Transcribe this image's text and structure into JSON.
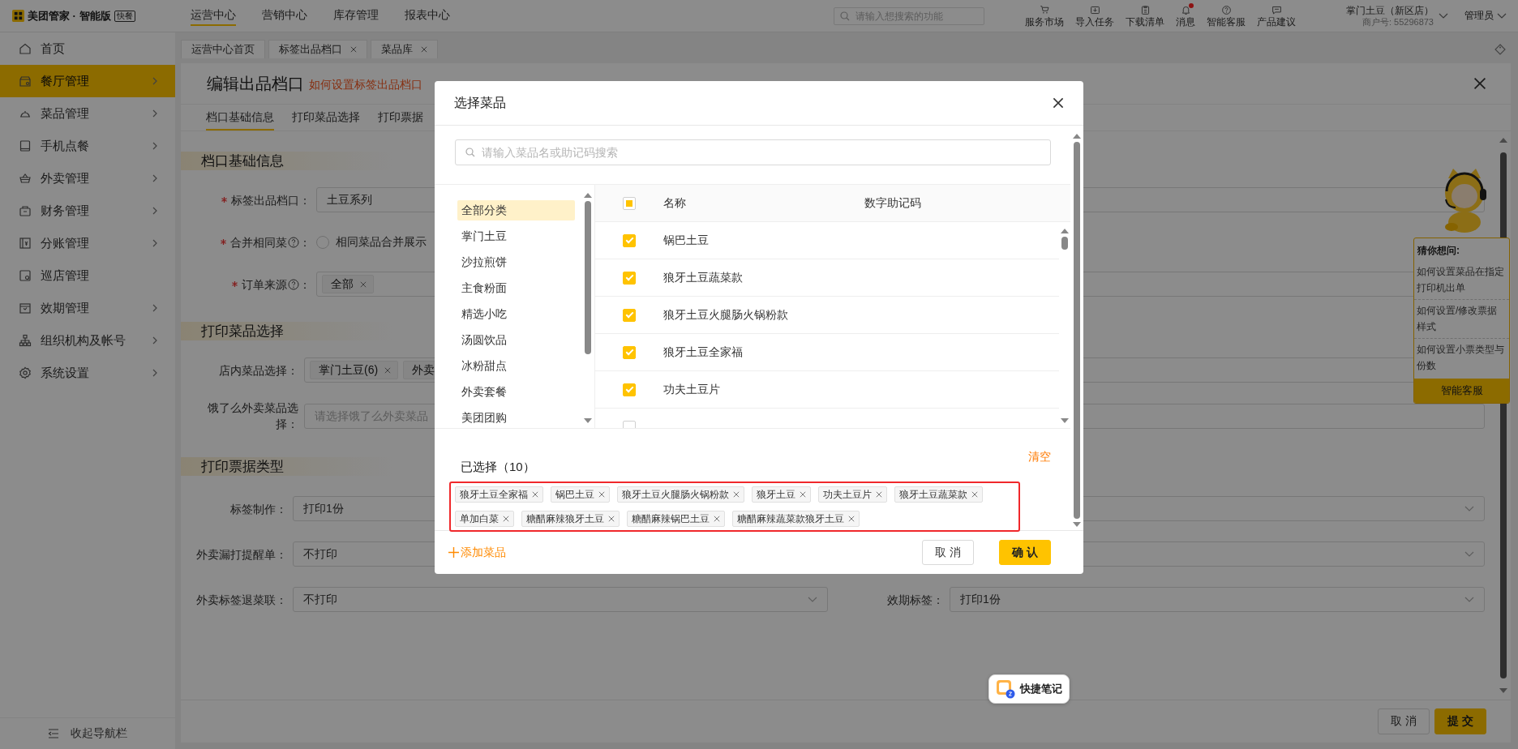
{
  "top_bar": {
    "brand": "美团管家 · 智能版",
    "edition_badge": "快餐",
    "nav": [
      {
        "label": "运营中心",
        "selected": true
      },
      {
        "label": "营销中心",
        "selected": false
      },
      {
        "label": "库存管理",
        "selected": false
      },
      {
        "label": "报表中心",
        "selected": false
      }
    ],
    "search": {
      "placeholder": "请输入想搜索的功能"
    },
    "tools": [
      {
        "label": "服务市场",
        "unread": false
      },
      {
        "label": "导入任务",
        "unread": false
      },
      {
        "label": "下载清单",
        "unread": false
      },
      {
        "label": "消息",
        "unread": true
      },
      {
        "label": "智能客服",
        "unread": false
      },
      {
        "label": "产品建议",
        "unread": false
      }
    ],
    "store": {
      "name": "掌门土豆（新区店）",
      "merchant_id": "商户号: 55296873"
    },
    "user": "管理员"
  },
  "sidebar": {
    "items": [
      {
        "label": "首页",
        "selected": false,
        "has_children": false
      },
      {
        "label": "餐厅管理",
        "selected": true,
        "has_children": true
      },
      {
        "label": "菜品管理",
        "selected": false,
        "has_children": true
      },
      {
        "label": "手机点餐",
        "selected": false,
        "has_children": true
      },
      {
        "label": "外卖管理",
        "selected": false,
        "has_children": true
      },
      {
        "label": "财务管理",
        "selected": false,
        "has_children": true
      },
      {
        "label": "分账管理",
        "selected": false,
        "has_children": true
      },
      {
        "label": "巡店管理",
        "selected": false,
        "has_children": false
      },
      {
        "label": "效期管理",
        "selected": false,
        "has_children": true
      },
      {
        "label": "组织机构及帐号",
        "selected": false,
        "has_children": true
      },
      {
        "label": "系统设置",
        "selected": false,
        "has_children": true
      }
    ],
    "collapse": "收起导航栏"
  },
  "page_tabs": [
    {
      "label": "运营中心首页",
      "closable": false
    },
    {
      "label": "标签出品档口",
      "closable": true
    },
    {
      "label": "菜品库",
      "closable": true
    }
  ],
  "editor": {
    "title": "编辑出品档口",
    "help_link": "如何设置标签出品档口",
    "tabs": [
      {
        "label": "档口基础信息",
        "selected": true
      },
      {
        "label": "打印菜品选择",
        "selected": false
      },
      {
        "label": "打印票据",
        "selected": false
      }
    ],
    "sections": [
      {
        "title": "档口基础信息",
        "fields": [
          {
            "kind": "input",
            "label": "标签出品档口：",
            "required": true,
            "help": false,
            "value": "土豆系列"
          },
          {
            "kind": "radio",
            "label": "合并相同菜",
            "required": true,
            "help": true,
            "colon": "：",
            "options": [
              {
                "label": "相同菜品合并展示",
                "selected": false
              }
            ]
          },
          {
            "kind": "tags",
            "label": "订单来源",
            "required": true,
            "help": true,
            "colon": "：",
            "tags": [
              {
                "label": "全部",
                "removable": true
              }
            ]
          }
        ]
      },
      {
        "title": "打印菜品选择",
        "fields": [
          {
            "kind": "tags",
            "label": "店内菜品选择：",
            "required": false,
            "help": false,
            "tags": [
              {
                "label": "掌门土豆(6)",
                "removable": true
              },
              {
                "label": "外卖",
                "removable": false
              }
            ]
          },
          {
            "kind": "input",
            "label": "饿了么外卖菜品选择：",
            "required": false,
            "help": false,
            "placeholder": "请选择饿了么外卖菜品"
          }
        ]
      },
      {
        "title": "打印票据类型",
        "fields": [
          {
            "kind": "select_pair",
            "label": "标签制作：",
            "required": false,
            "help": false,
            "value": "打印1份"
          },
          {
            "kind": "select_pair",
            "label": "外卖漏打提醒单：",
            "required": false,
            "help": false,
            "value": "不打印"
          },
          {
            "kind": "select_pair",
            "label": "外卖标签退菜联：",
            "required": false,
            "help": false,
            "value": "不打印",
            "right_label": "效期标签：",
            "right_value": "打印1份"
          }
        ]
      }
    ],
    "footer": {
      "cancel": "取 消",
      "submit": "提 交"
    }
  },
  "assistant": {
    "title": "猜你想问:",
    "questions": [
      "如何设置菜品在指定打印机出单",
      "如何设置/修改票据样式",
      "如何设置小票类型与份数"
    ],
    "button": "智能客服"
  },
  "modal": {
    "title": "选择菜品",
    "search": {
      "placeholder": "请输入菜品名或助记码搜索"
    },
    "categories": [
      {
        "label": "全部分类",
        "selected": true
      },
      {
        "label": "掌门土豆",
        "selected": false
      },
      {
        "label": "沙拉煎饼",
        "selected": false
      },
      {
        "label": "主食粉面",
        "selected": false
      },
      {
        "label": "精选小吃",
        "selected": false
      },
      {
        "label": "汤圆饮品",
        "selected": false
      },
      {
        "label": "冰粉甜点",
        "selected": false
      },
      {
        "label": "外卖套餐",
        "selected": false
      },
      {
        "label": "美团团购",
        "selected": false
      }
    ],
    "select_all": {
      "indeterminate": true
    },
    "columns": [
      "名称",
      "数字助记码"
    ],
    "rows": [
      {
        "name": "锅巴土豆",
        "checked": true
      },
      {
        "name": "狼牙土豆蔬菜款",
        "checked": true
      },
      {
        "name": "狼牙土豆火腿肠火锅粉款",
        "checked": true
      },
      {
        "name": "狼牙土豆全家福",
        "checked": true
      },
      {
        "name": "功夫土豆片",
        "checked": true
      },
      {
        "checked": false
      }
    ],
    "selected_label": "已选择（10）",
    "clear": "清空",
    "chips": [
      "狼牙土豆全家福",
      "锅巴土豆",
      "狼牙土豆火腿肠火锅粉款",
      "狼牙土豆",
      "功夫土豆片",
      "狼牙土豆蔬菜款",
      "单加白菜",
      "糖醋麻辣狼牙土豆",
      "糖醋麻辣锅巴土豆",
      "糖醋麻辣蔬菜款狼牙土豆"
    ],
    "add": "添加菜品",
    "cancel": "取 消",
    "confirm": "确 认"
  },
  "quick_note": {
    "label": "快捷笔记"
  }
}
